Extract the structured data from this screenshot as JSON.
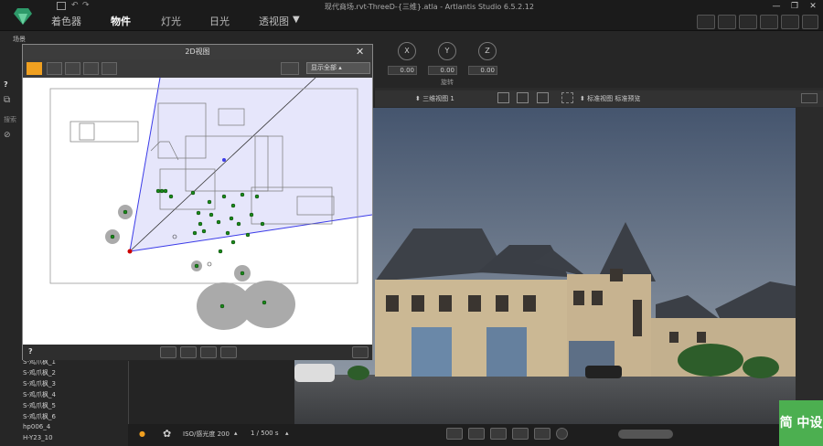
{
  "window": {
    "title": "现代商场.rvt-ThreeD-{三维}.atla - Artlantis Studio 6.5.2.12"
  },
  "tabs": [
    {
      "label": "着色器"
    },
    {
      "label": "物件"
    },
    {
      "label": "灯光"
    },
    {
      "label": "日光"
    },
    {
      "label": "透视图"
    }
  ],
  "scene_label": "场景",
  "axes": {
    "x": "X",
    "y": "Y",
    "z": "Z"
  },
  "rotation": {
    "x": "0.00",
    "y": "0.00",
    "z": "0.00",
    "label": "旋转"
  },
  "help": "?",
  "search_label": "搜索",
  "dialog": {
    "title": "2D视图",
    "dropdown": "显示全部",
    "help": "?"
  },
  "viewport": {
    "view_name": "三维视图 1",
    "std_label": "标准视图 标准预览"
  },
  "left_list": [
    "S-鸡爪枫_1",
    "S-鸡爪枫_2",
    "S-鸡爪枫_3",
    "S-鸡爪枫_4",
    "S-鸡爪枫_5",
    "S-鸡爪枫_6",
    "hp006_4",
    "H-Y23_10"
  ],
  "bottom": {
    "iso": "ISO/感光度 200",
    "shutter": "1 / 500 s"
  },
  "badge": "简\n中设",
  "colors": {
    "accent": "#f0a020",
    "marker": "#1a8a1a",
    "camera": "#cc0000",
    "frustum": "#3b3be8"
  }
}
